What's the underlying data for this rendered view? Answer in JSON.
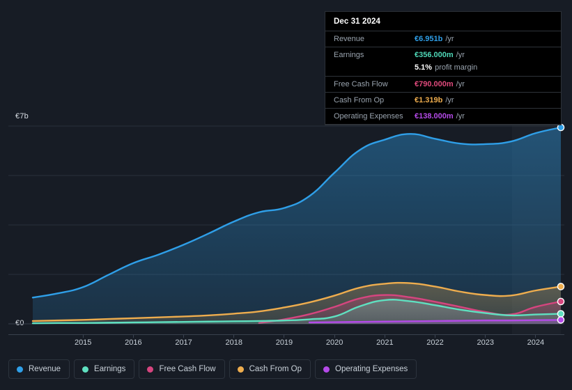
{
  "tooltip": {
    "date": "Dec 31 2024",
    "rows": [
      {
        "key": "Revenue",
        "value": "€6.951b",
        "unit": "/yr",
        "color": "#2f9fe8"
      },
      {
        "key": "Earnings",
        "value": "€356.000m",
        "unit": "/yr",
        "color": "#4fd8b8"
      },
      {
        "key": "Free Cash Flow",
        "value": "€790.000m",
        "unit": "/yr",
        "color": "#e04a7c"
      },
      {
        "key": "Cash From Op",
        "value": "€1.319b",
        "unit": "/yr",
        "color": "#eead4e"
      },
      {
        "key": "Operating Expenses",
        "value": "€138.000m",
        "unit": "/yr",
        "color": "#b44ae8"
      }
    ],
    "profit_margin_value": "5.1%",
    "profit_margin_label": "profit margin"
  },
  "legend": {
    "items": [
      {
        "label": "Revenue",
        "color": "#2f9fe8"
      },
      {
        "label": "Earnings",
        "color": "#5fe0c0"
      },
      {
        "label": "Free Cash Flow",
        "color": "#d6457f"
      },
      {
        "label": "Cash From Op",
        "color": "#eead4e"
      },
      {
        "label": "Operating Expenses",
        "color": "#b44ae8"
      }
    ]
  },
  "axis": {
    "y_top_label": "€7b",
    "y_zero_label": "€0",
    "x_labels": [
      "2015",
      "2016",
      "2017",
      "2018",
      "2019",
      "2020",
      "2021",
      "2022",
      "2023",
      "2024"
    ]
  },
  "chart_data": {
    "type": "area",
    "title": "",
    "xlabel": "",
    "ylabel": "",
    "ylim": [
      0,
      7
    ],
    "y_unit": "EUR billions",
    "currency": "EUR",
    "grid": true,
    "legend_position": "bottom",
    "x_tick_labels": [
      "2015",
      "2016",
      "2017",
      "2018",
      "2019",
      "2020",
      "2021",
      "2022",
      "2023",
      "2024"
    ],
    "x": [
      2014.5,
      2015,
      2015.5,
      2016,
      2016.5,
      2017,
      2017.5,
      2018,
      2018.5,
      2019,
      2019.5,
      2020,
      2020.5,
      2021,
      2021.5,
      2022,
      2022.5,
      2023,
      2023.5,
      2024,
      2024.5,
      2025
    ],
    "series": [
      {
        "name": "Revenue",
        "color": "#2f9fe8",
        "values": [
          0.93,
          1.08,
          1.3,
          1.73,
          2.15,
          2.45,
          2.8,
          3.2,
          3.62,
          3.95,
          4.1,
          4.52,
          5.35,
          6.15,
          6.52,
          6.72,
          6.55,
          6.38,
          6.36,
          6.45,
          6.75,
          6.951
        ]
      },
      {
        "name": "Earnings",
        "color": "#5fe0c0",
        "values": [
          0.02,
          0.03,
          0.03,
          0.04,
          0.05,
          0.06,
          0.07,
          0.08,
          0.09,
          0.1,
          0.12,
          0.16,
          0.26,
          0.62,
          0.84,
          0.8,
          0.66,
          0.5,
          0.38,
          0.3,
          0.33,
          0.356
        ]
      },
      {
        "name": "Free Cash Flow",
        "color": "#d6457f",
        "values": [
          null,
          null,
          null,
          null,
          null,
          null,
          null,
          null,
          null,
          0.03,
          0.16,
          0.34,
          0.6,
          0.9,
          1.02,
          0.94,
          0.78,
          0.6,
          0.42,
          0.33,
          0.6,
          0.79
        ]
      },
      {
        "name": "Cash From Op",
        "color": "#eead4e",
        "values": [
          0.1,
          0.12,
          0.14,
          0.17,
          0.2,
          0.23,
          0.26,
          0.3,
          0.36,
          0.44,
          0.58,
          0.76,
          1.0,
          1.28,
          1.42,
          1.44,
          1.32,
          1.14,
          1.02,
          1.0,
          1.18,
          1.319
        ]
      },
      {
        "name": "Operating Expenses",
        "color": "#b44ae8",
        "values": [
          null,
          null,
          null,
          null,
          null,
          null,
          null,
          null,
          null,
          null,
          null,
          0.05,
          0.06,
          0.07,
          0.08,
          0.09,
          0.1,
          0.11,
          0.12,
          0.12,
          0.13,
          0.138
        ]
      }
    ],
    "end_markers": [
      {
        "name": "Revenue",
        "value": 6.951
      },
      {
        "name": "Cash From Op",
        "value": 1.319
      },
      {
        "name": "Free Cash Flow",
        "value": 0.79
      },
      {
        "name": "Earnings",
        "value": 0.356
      },
      {
        "name": "Operating Expenses",
        "value": 0.138
      }
    ]
  }
}
